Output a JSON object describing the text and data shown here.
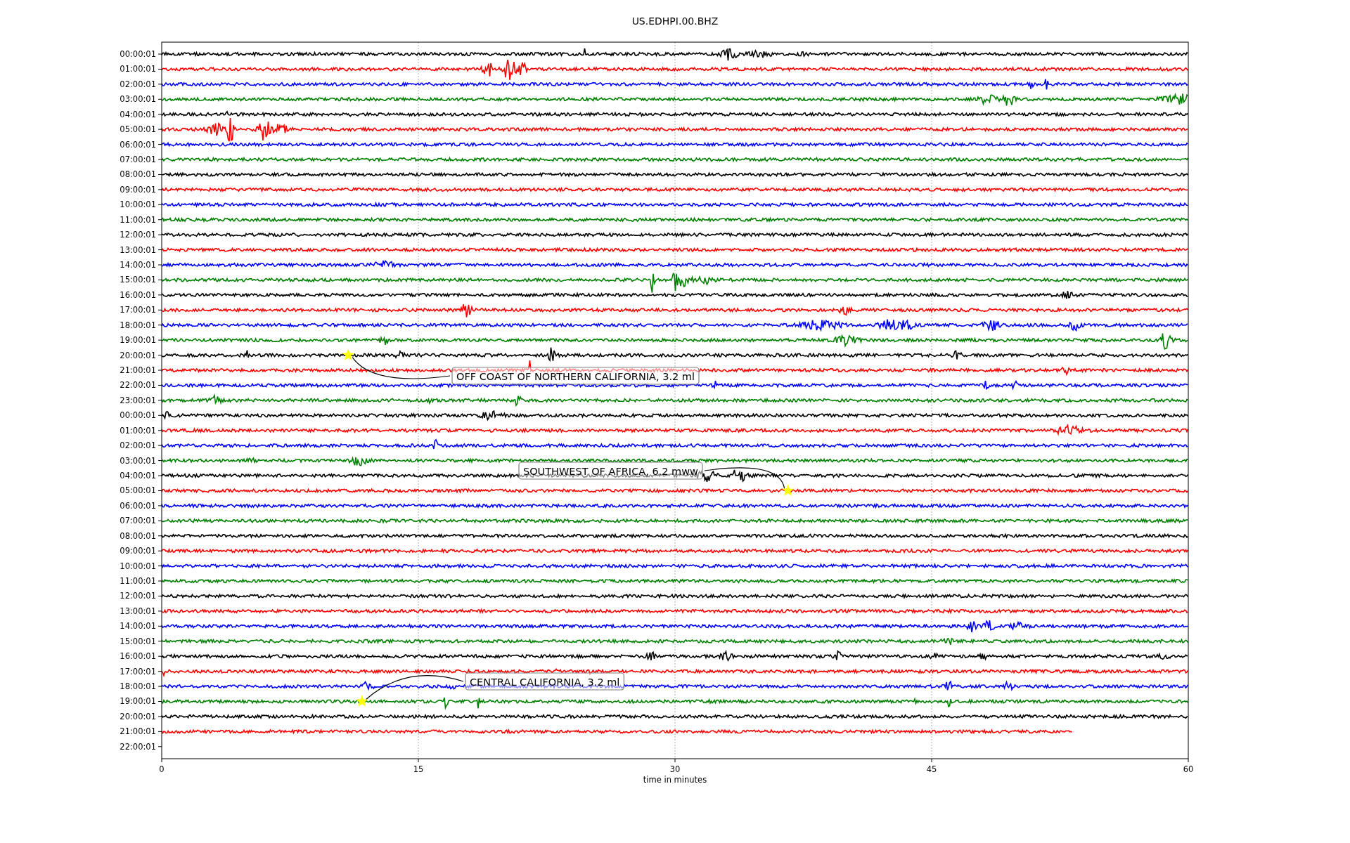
{
  "title": "US.EDHPI.00.BHZ",
  "rows": [
    {
      "label": "00:00:01",
      "color": "#000000"
    },
    {
      "label": "01:00:01",
      "color": "#ff0000"
    },
    {
      "label": "02:00:01",
      "color": "#0000ff"
    },
    {
      "label": "03:00:01",
      "color": "#008000"
    },
    {
      "label": "04:00:01",
      "color": "#000000"
    },
    {
      "label": "05:00:01",
      "color": "#ff0000"
    },
    {
      "label": "06:00:01",
      "color": "#0000ff"
    },
    {
      "label": "07:00:01",
      "color": "#008000"
    },
    {
      "label": "08:00:01",
      "color": "#000000"
    },
    {
      "label": "09:00:01",
      "color": "#ff0000"
    },
    {
      "label": "10:00:01",
      "color": "#0000ff"
    },
    {
      "label": "11:00:01",
      "color": "#008000"
    },
    {
      "label": "12:00:01",
      "color": "#000000"
    },
    {
      "label": "13:00:01",
      "color": "#ff0000"
    },
    {
      "label": "14:00:01",
      "color": "#0000ff"
    },
    {
      "label": "15:00:01",
      "color": "#008000"
    },
    {
      "label": "16:00:01",
      "color": "#000000"
    },
    {
      "label": "17:00:01",
      "color": "#ff0000"
    },
    {
      "label": "18:00:01",
      "color": "#0000ff"
    },
    {
      "label": "19:00:01",
      "color": "#008000"
    },
    {
      "label": "20:00:01",
      "color": "#000000"
    },
    {
      "label": "21:00:01",
      "color": "#ff0000"
    },
    {
      "label": "22:00:01",
      "color": "#0000ff"
    },
    {
      "label": "23:00:01",
      "color": "#008000"
    },
    {
      "label": "00:00:01",
      "color": "#000000"
    },
    {
      "label": "01:00:01",
      "color": "#ff0000"
    },
    {
      "label": "02:00:01",
      "color": "#0000ff"
    },
    {
      "label": "03:00:01",
      "color": "#008000"
    },
    {
      "label": "04:00:01",
      "color": "#000000"
    },
    {
      "label": "05:00:01",
      "color": "#ff0000"
    },
    {
      "label": "06:00:01",
      "color": "#0000ff"
    },
    {
      "label": "07:00:01",
      "color": "#008000"
    },
    {
      "label": "08:00:01",
      "color": "#000000"
    },
    {
      "label": "09:00:01",
      "color": "#ff0000"
    },
    {
      "label": "10:00:01",
      "color": "#0000ff"
    },
    {
      "label": "11:00:01",
      "color": "#008000"
    },
    {
      "label": "12:00:01",
      "color": "#000000"
    },
    {
      "label": "13:00:01",
      "color": "#ff0000"
    },
    {
      "label": "14:00:01",
      "color": "#0000ff"
    },
    {
      "label": "15:00:01",
      "color": "#008000"
    },
    {
      "label": "16:00:01",
      "color": "#000000"
    },
    {
      "label": "17:00:01",
      "color": "#ff0000"
    },
    {
      "label": "18:00:01",
      "color": "#0000ff"
    },
    {
      "label": "19:00:01",
      "color": "#008000"
    },
    {
      "label": "20:00:01",
      "color": "#000000"
    },
    {
      "label": "21:00:01",
      "color": "#ff0000"
    },
    {
      "label": "22:00:01"
    }
  ],
  "x_axis": {
    "ticks": [
      "0",
      "15",
      "30",
      "45",
      "60"
    ],
    "label": "time in minutes"
  },
  "events": [
    {
      "label": "OFF COAST OF NORTHERN CALIFORNIA, 3.2 ml"
    },
    {
      "label": "SOUTHWEST OF AFRICA, 6.2 mww"
    },
    {
      "label": "CENTRAL CALIFORNIA, 3.2 ml"
    }
  ]
}
